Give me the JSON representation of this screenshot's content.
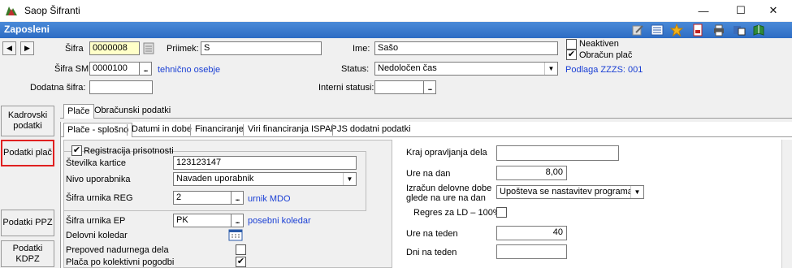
{
  "window": {
    "title": "Saop Šifranti",
    "subtitle": "Zaposleni",
    "minimize": "—",
    "maximize": "☐",
    "close": "✕"
  },
  "nav": {
    "prev": "◀",
    "next": "▶"
  },
  "header": {
    "sifra_label": "Šifra",
    "sifra_value": "0000008",
    "priimek_label": "Priimek:",
    "priimek_value": "S",
    "ime_label": "Ime:",
    "ime_value": "Sašo",
    "neaktiven_label": "Neaktiven",
    "obracun_label": "Obračun plač",
    "sifra_sm_label": "Šifra SM",
    "sifra_sm_value": "0000100",
    "sifra_sm_link": "tehnično osebje",
    "status_label": "Status:",
    "status_value": "Nedoločen čas",
    "podlaga_link": "Podlaga ZZZS: 001",
    "dodatna_label": "Dodatna šifra:",
    "dodatna_value": "",
    "interni_label": "Interni statusi:",
    "interni_value": "",
    "dots": "..."
  },
  "side_buttons": [
    "Kadrovski podatki",
    "Podatki  plač",
    "Podatki   PPZ",
    "Podatki KDPZ"
  ],
  "tabs_top": [
    "Plače",
    "Obračunski podatki"
  ],
  "tabs_sub": [
    "Plače - splošno",
    "Datumi in dobe",
    "Financiranje",
    "Viri financiranja ISPAP",
    "JS dodatni podatki"
  ],
  "left_panel": {
    "registracija_label": "Registracija prisotnosti",
    "kartica_label": "Številka kartice",
    "kartica_value": "123123147",
    "nivo_label": "Nivo uporabnika",
    "nivo_value": "Navaden uporabnik",
    "urnik_reg_label": "Šifra urnika REG",
    "urnik_reg_value": "2",
    "urnik_reg_link": "urnik MDO",
    "urnik_ep_label": "Šifra urnika EP",
    "urnik_ep_value": "PK",
    "urnik_ep_link": "posebni koledar",
    "koledar_label": "Delovni koledar",
    "prepoved_label": "Prepoved nadurnega dela",
    "kolektivna_label": "Plača po kolektivni pogodbi"
  },
  "right_panel": {
    "kraj_label": "Kraj opravljanja dela",
    "kraj_value": "",
    "ure_dan_label": "Ure na dan",
    "ure_dan_value": "8,00",
    "izracun_label_1": "Izračun delovne dobe",
    "izracun_label_2": "glede na ure na dan",
    "izracun_value": "Upošteva se nastavitev programa",
    "regres_label": "Regres za LD – 100%",
    "ure_teden_label": "Ure na teden",
    "ure_teden_value": "40",
    "dni_teden_label": "Dni na teden",
    "dni_teden_value": ""
  },
  "colors": {
    "accent_bar": "#2d6cc4",
    "highlight_border": "#e02020",
    "link": "#1a3fd4",
    "yellow_field": "#ffffc8"
  }
}
